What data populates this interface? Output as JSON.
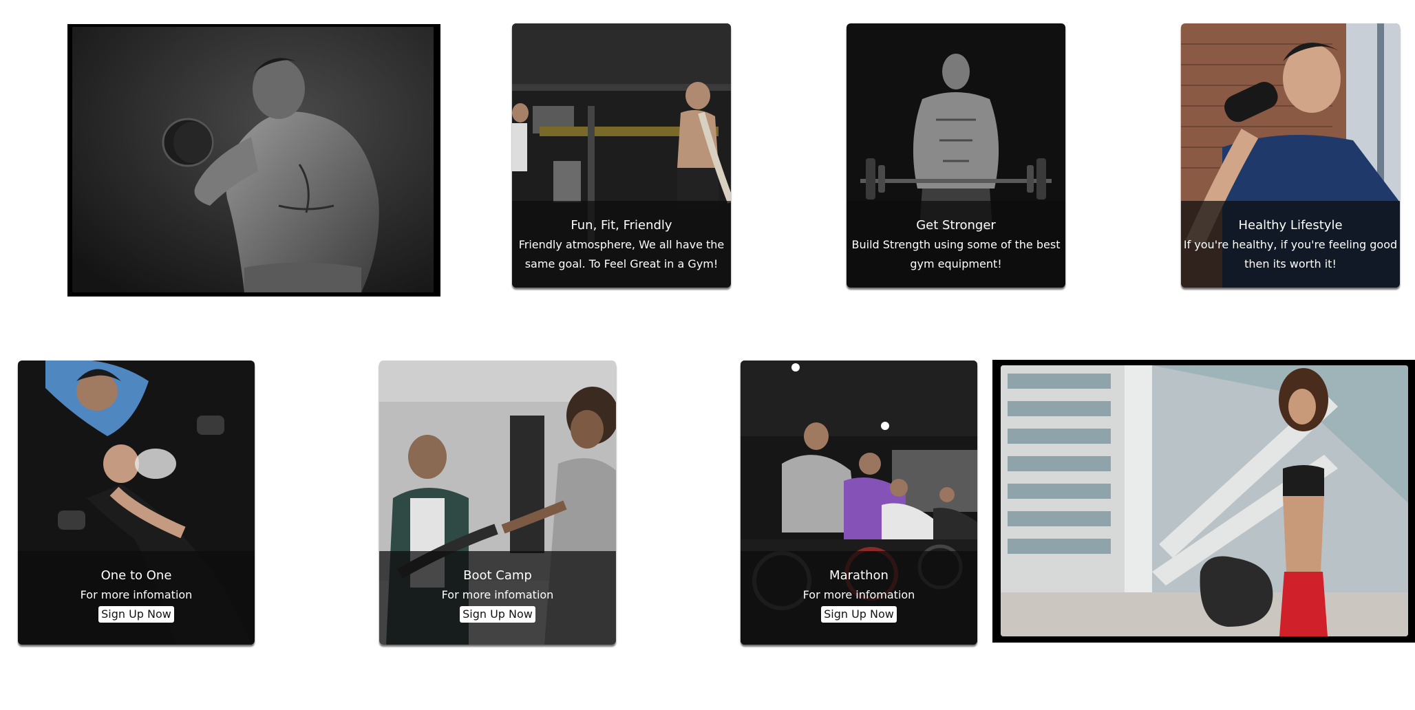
{
  "top_row": {
    "feature_image": {
      "icon": "bodybuilder-dumbbell-photo"
    },
    "cards": [
      {
        "title": "Fun, Fit, Friendly",
        "text": "Friendly atmosphere, We all have the same goal. To Feel Great in a Gym!",
        "icon": "battle-ropes-gym-photo"
      },
      {
        "title": "Get Stronger",
        "text": "Build Strength using some of the best gym equipment!",
        "icon": "barbell-athlete-photo"
      },
      {
        "title": "Healthy Lifestyle",
        "text": "If you're healthy, if you're feeling good then its worth it!",
        "icon": "man-drinking-shaker-photo"
      }
    ]
  },
  "bottom_row": {
    "cards": [
      {
        "title": "One to One",
        "text": "For more infomation",
        "button": "Sign Up Now",
        "icon": "personal-trainer-photo"
      },
      {
        "title": "Boot Camp",
        "text": "For more infomation",
        "button": "Sign Up Now",
        "icon": "bootcamp-ropes-photo"
      },
      {
        "title": "Marathon",
        "text": "For more infomation",
        "button": "Sign Up Now",
        "icon": "spin-class-cyclists-photo"
      }
    ],
    "feature_image": {
      "icon": "woman-with-gym-bag-photo"
    }
  },
  "colors": {
    "caption_overlay": "#0c0c0c",
    "caption_text": "#ffffff",
    "button_bg": "#ffffff",
    "frame": "#000000"
  }
}
